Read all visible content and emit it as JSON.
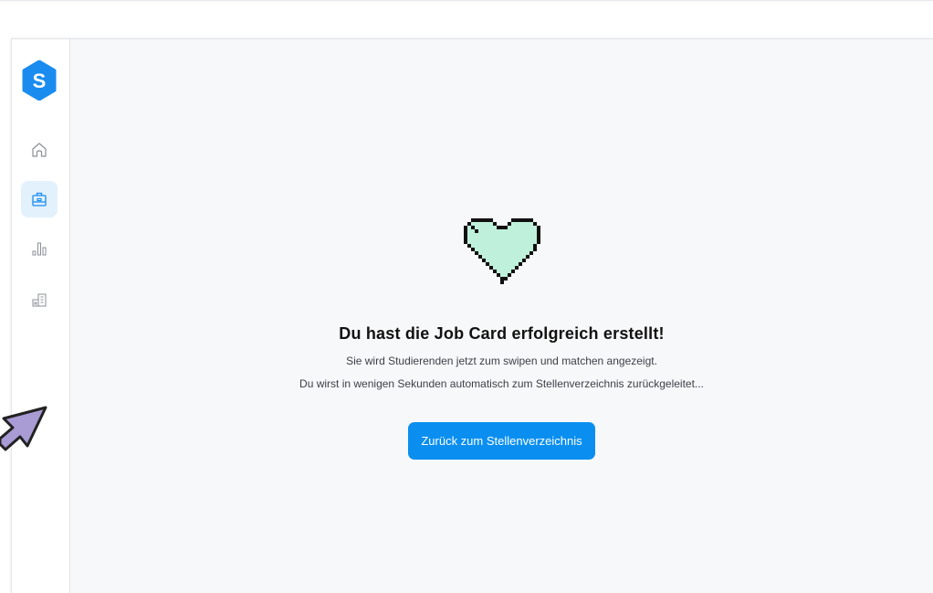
{
  "logo": {
    "letter": "S",
    "icon": "logo-icon",
    "color": "#1a8cf0"
  },
  "nav": [
    {
      "icon": "home-icon",
      "active": false
    },
    {
      "icon": "briefcase-icon",
      "active": true
    },
    {
      "icon": "bar-chart-icon",
      "active": false
    },
    {
      "icon": "building-icon",
      "active": false
    }
  ],
  "success": {
    "heart_icon": "pixel-heart-icon",
    "heart_color": "#bff0dc",
    "title": "Du hast die Job Card erfolgreich erstellt!",
    "subtitle": "Sie wird Studierenden jetzt zum swipen und matchen angezeigt.",
    "redirect_notice": "Du wirst in wenigen Sekunden automatisch zum Stellenverzeichnis zurückgeleitet...",
    "button_label": "Zurück zum Stellenverzeichnis"
  },
  "colors": {
    "accent": "#0a8ff0",
    "active_nav_bg": "#e3f1fd",
    "cursor": "#a99bd4"
  }
}
